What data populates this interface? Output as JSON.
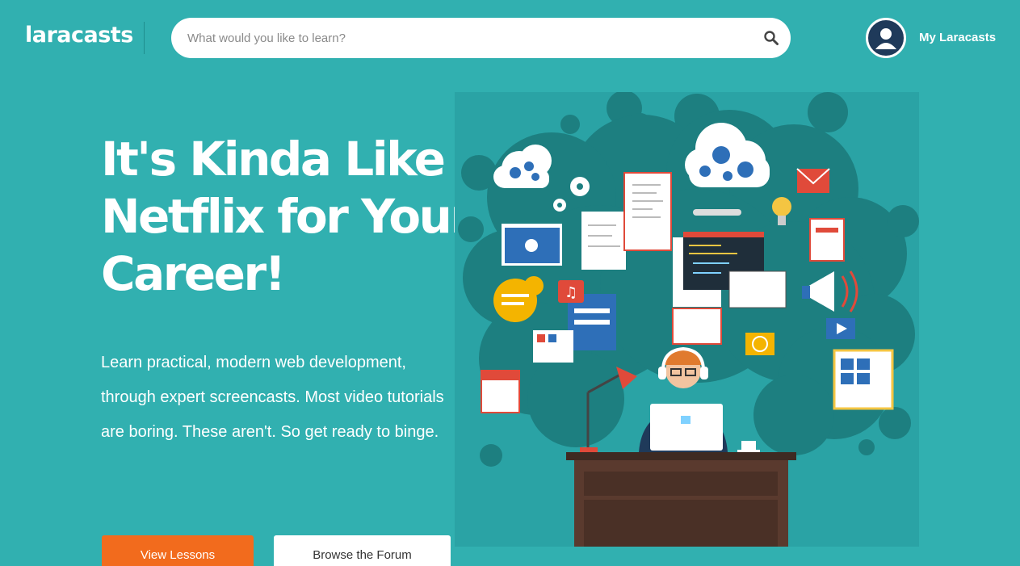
{
  "header": {
    "logo": "laracasts",
    "search_placeholder": "What would you like to learn?",
    "account_link": "My Laracasts"
  },
  "hero": {
    "title_lines": [
      "It's Kinda Like",
      "Netflix for Your",
      "Career!"
    ],
    "description": "Learn practical, modern web development, through expert screencasts. Most video tutorials are boring. These aren't. So get ready to binge.",
    "primary_button": "View Lessons",
    "secondary_button": "Browse the Forum"
  },
  "colors": {
    "background": "#31b0b0",
    "primary_button": "#f26b1d",
    "avatar": "#1f3a5a",
    "illustration_blob": "#1d7f80"
  },
  "icons": [
    "search-icon",
    "user-avatar-icon"
  ]
}
